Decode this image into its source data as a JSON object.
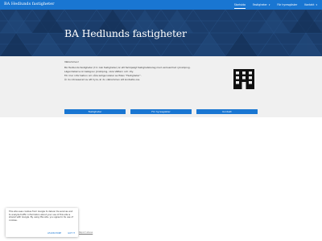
{
  "header": {
    "site_title": "BA Hedlunds fastigheter",
    "nav": [
      {
        "label": "Startsida",
        "active": true,
        "dropdown": false
      },
      {
        "label": "Fastigheter",
        "active": false,
        "dropdown": true
      },
      {
        "label": "För hyresgäster",
        "active": false,
        "dropdown": false
      },
      {
        "label": "Kontakt",
        "active": false,
        "dropdown": true
      }
    ]
  },
  "hero": {
    "title": "BA Hedlunds fastigheter"
  },
  "main": {
    "intro": [
      "Välkommen!",
      "",
      "BA Hedlunds fastigheter (f.d. Cek fastigheter) är ett familjeägt fastighetsbolag med verksamhet i Jönköping.",
      "Lägenheterna är belägna i Jönköping, nära Vättern och city.",
      "För mer information om våra lediga lokaler se fliken \"Fastigheter\".",
      "Är du intresserad av att hyra, är du välkommen att kontakta oss."
    ],
    "buttons": [
      {
        "label": "Fastigheter"
      },
      {
        "label": "För hyresgäster"
      },
      {
        "label": "Kontakt"
      }
    ],
    "icon": "building-icon"
  },
  "cookie": {
    "text": "This site uses cookies from Google to deliver its services and to analyze traffic. Information about your use of this site is shared with Google. By using this site, you agree to its use of cookies.",
    "learn_more": "Learn more",
    "got_it": "Got it"
  },
  "footer": {
    "report_abuse": "Report abuse"
  },
  "colors": {
    "accent": "#1976d2",
    "hero_bg": "#1b3d6b",
    "content_bg": "#f0f0f0"
  }
}
